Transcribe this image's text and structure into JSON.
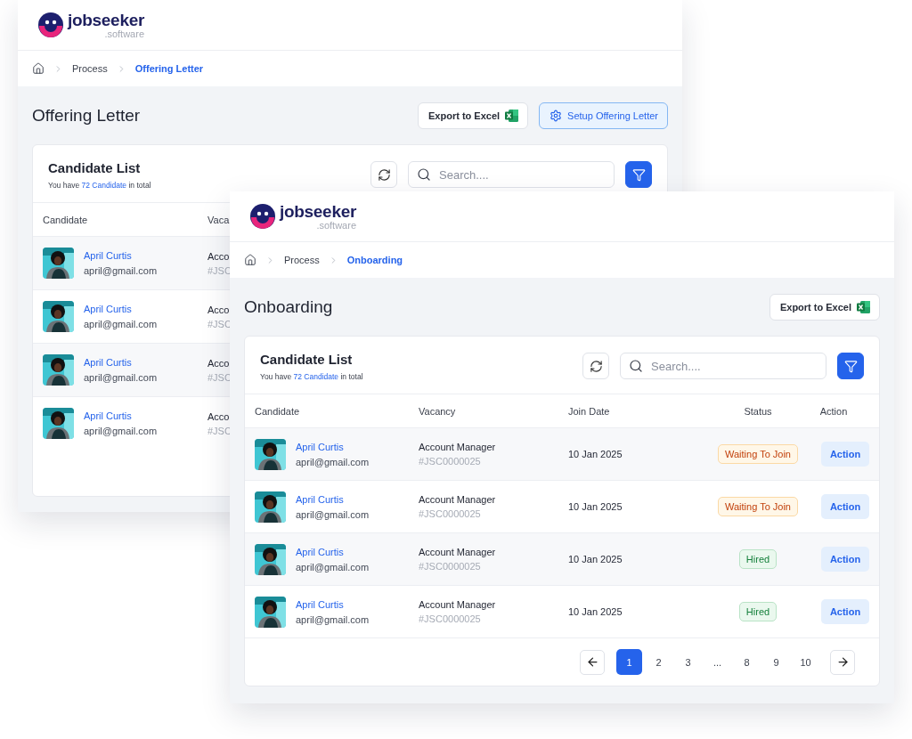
{
  "back_window": {
    "logo": {
      "name": "jobseeker",
      "suffix": ".software"
    },
    "breadcrumbs": [
      {
        "label": "Process",
        "current": false
      },
      {
        "label": "Offering Letter",
        "current": true
      }
    ],
    "title": "Offering Letter",
    "buttons": [
      {
        "label": "Export to Excel",
        "kind": "excel"
      },
      {
        "label": "Setup Offering Letter",
        "kind": "setup"
      }
    ],
    "card": {
      "title": "Candidate List",
      "summary": {
        "before": "You have",
        "count": "72 Candidate",
        "after": "in total"
      },
      "search": {
        "placeholder": "Search...."
      }
    },
    "table": {
      "columns": [
        "Candidate",
        "Vaca"
      ],
      "rows": [
        {
          "name": "April Curtis",
          "email": "april@gmail.com",
          "vacancy": "Acco",
          "code": "#JSC"
        },
        {
          "name": "April Curtis",
          "email": "april@gmail.com",
          "vacancy": "Acco",
          "code": "#JSC"
        },
        {
          "name": "April Curtis",
          "email": "april@gmail.com",
          "vacancy": "Acco",
          "code": "#JSC"
        },
        {
          "name": "April Curtis",
          "email": "april@gmail.com",
          "vacancy": "Acco",
          "code": "#JSC"
        }
      ]
    }
  },
  "front_window": {
    "logo": {
      "name": "jobseeker",
      "suffix": ".software"
    },
    "breadcrumbs": [
      {
        "label": "Process",
        "current": false
      },
      {
        "label": "Onboarding",
        "current": true
      }
    ],
    "title": "Onboarding",
    "buttons": [
      {
        "label": "Export to Excel",
        "kind": "excel"
      }
    ],
    "card": {
      "title": "Candidate List",
      "summary": {
        "before": "You have",
        "count": "72 Candidate",
        "after": "in total"
      },
      "search": {
        "placeholder": "Search...."
      }
    },
    "table": {
      "columns": [
        "Candidate",
        "Vacancy",
        "Join Date",
        "Status",
        "Action"
      ],
      "rows": [
        {
          "name": "April Curtis",
          "email": "april@gmail.com",
          "vacancy": "Account Manager",
          "code": "#JSC0000025",
          "join_date": "10 Jan 2025",
          "status": {
            "label": "Waiting To Join",
            "kind": "waiting"
          },
          "action": "Action"
        },
        {
          "name": "April Curtis",
          "email": "april@gmail.com",
          "vacancy": "Account Manager",
          "code": "#JSC0000025",
          "join_date": "10 Jan 2025",
          "status": {
            "label": "Waiting To Join",
            "kind": "waiting"
          },
          "action": "Action"
        },
        {
          "name": "April Curtis",
          "email": "april@gmail.com",
          "vacancy": "Account Manager",
          "code": "#JSC0000025",
          "join_date": "10 Jan 2025",
          "status": {
            "label": "Hired",
            "kind": "hired"
          },
          "action": "Action"
        },
        {
          "name": "April Curtis",
          "email": "april@gmail.com",
          "vacancy": "Account Manager",
          "code": "#JSC0000025",
          "join_date": "10 Jan 2025",
          "status": {
            "label": "Hired",
            "kind": "hired"
          },
          "action": "Action"
        }
      ]
    },
    "pagination": [
      {
        "label": "1",
        "selected": true
      },
      {
        "label": "2",
        "selected": false
      },
      {
        "label": "3",
        "selected": false
      },
      {
        "label": "...",
        "selected": false
      },
      {
        "label": "8",
        "selected": false
      },
      {
        "label": "9",
        "selected": false
      },
      {
        "label": "10",
        "selected": false
      }
    ]
  }
}
